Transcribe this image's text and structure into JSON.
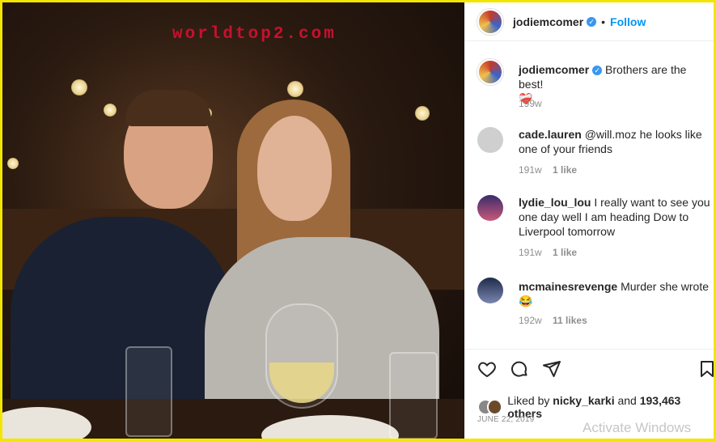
{
  "watermark": "worldtop2.com",
  "post": {
    "username": "jodiemcomer",
    "follow_label": "Follow",
    "caption": "Brothers are the best!",
    "caption_emoji": "❤️‍🩹",
    "caption_time": "199w"
  },
  "comments": [
    {
      "user": "cade.lauren",
      "text": "@will.moz he looks like one of your friends",
      "time": "191w",
      "likes": "1 like"
    },
    {
      "user": "lydie_lou_lou",
      "text": "I really want to see you one day well I am heading Dow to Liverpool tomorrow",
      "time": "191w",
      "likes": "1 like"
    },
    {
      "user": "mcmainesrevenge",
      "text": "Murder she wrote😂",
      "time": "192w",
      "likes": "11 likes"
    }
  ],
  "likes_line": {
    "prefix": "Liked by",
    "user": "nicky_karki",
    "suffix": "and",
    "count": "193,463 others"
  },
  "date": "JUNE 22, 2019",
  "activate": "Activate Windows",
  "icons": [
    "heart-icon",
    "comment-icon",
    "share-icon",
    "bookmark-icon"
  ]
}
